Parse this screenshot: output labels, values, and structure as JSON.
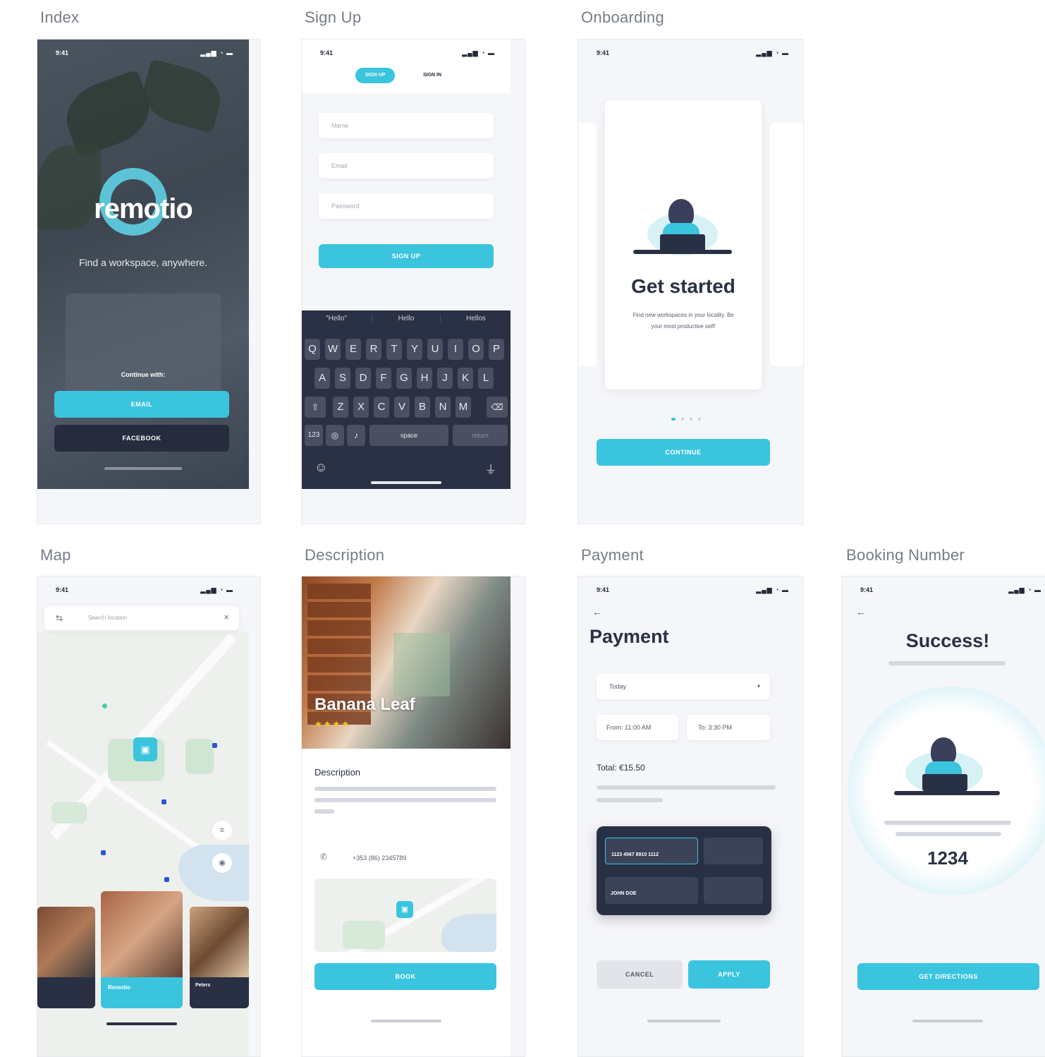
{
  "labels": {
    "index": "Index",
    "signup": "Sign Up",
    "onboarding": "Onboarding",
    "map": "Map",
    "description": "Description",
    "payment": "Payment",
    "booking": "Booking Number"
  },
  "status": {
    "time": "9:41",
    "icons": "▂▄▆ ◔ ▬"
  },
  "index": {
    "brand": "remotio",
    "tagline": "Find a workspace, anywhere.",
    "continue_with": "Continue with:",
    "email_button": "EMAIL",
    "facebook_button": "FACEBOOK"
  },
  "signup": {
    "tab_active": "SIGN UP",
    "tab_inactive": "SIGN IN",
    "name_placeholder": "Name",
    "email_placeholder": "Email",
    "password_placeholder": "Password",
    "submit": "SIGN UP",
    "suggestions": [
      "\"Hello\"",
      "Hello",
      "Hellos"
    ],
    "row1": [
      "Q",
      "W",
      "E",
      "R",
      "T",
      "Y",
      "U",
      "I",
      "O",
      "P"
    ],
    "row2": [
      "A",
      "S",
      "D",
      "F",
      "G",
      "H",
      "J",
      "K",
      "L"
    ],
    "row3": [
      "Z",
      "X",
      "C",
      "V",
      "B",
      "N",
      "M"
    ],
    "space": "space",
    "return": "return"
  },
  "onboarding": {
    "title": "Get started",
    "body_line1": "Find new workspaces in your locality. Be",
    "body_line2": "your most productive self!",
    "continue": "CONTINUE"
  },
  "map": {
    "search_placeholder": "Search location",
    "cards": [
      {
        "name": "",
        "sub": ""
      },
      {
        "name": "Remotio",
        "sub": ""
      },
      {
        "name": "Peters",
        "sub": ""
      }
    ]
  },
  "description": {
    "venue": "Banana Leaf",
    "rating_stars": "★★★★",
    "heading": "Description",
    "phone": "+353 (86) 2345789",
    "book": "BOOK"
  },
  "payment": {
    "title": "Payment",
    "date_value": "Today",
    "from": "From: 11:00 AM",
    "to": "To: 3:30 PM",
    "total": "Total: €15.50",
    "card_number": "1123 4567 8910 1112",
    "card_name": "JOHN DOE",
    "cancel": "CANCEL",
    "apply": "APPLY"
  },
  "booking": {
    "title": "Success!",
    "number": "1234",
    "directions": "GET DIRECTIONS"
  },
  "colors": {
    "accent": "#3ac4de",
    "dark": "#2a3044",
    "background": "#f5f6f9"
  }
}
